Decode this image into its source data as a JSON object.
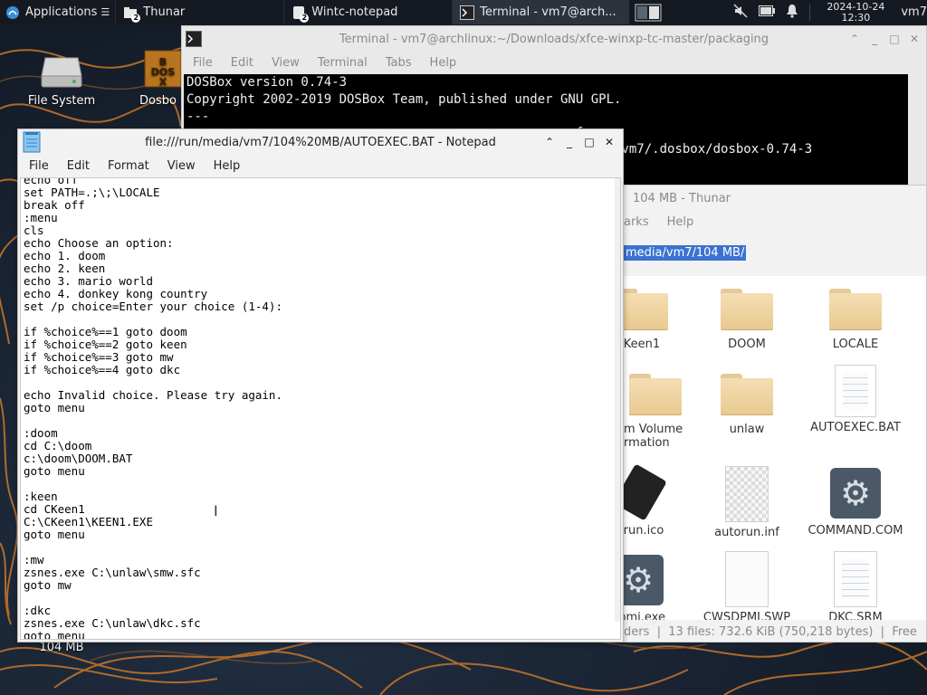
{
  "panel": {
    "applications_label": "Applications",
    "tasks": [
      {
        "label": "Thunar",
        "badge": "2"
      },
      {
        "label": "Wintc-notepad",
        "badge": "2"
      },
      {
        "label": "Terminal - vm7@arch..."
      }
    ],
    "clock_date": "2024-10-24",
    "clock_time": "12:30",
    "user": "vm7"
  },
  "desktop": {
    "icons": [
      {
        "label": "File System"
      },
      {
        "label": "Dosbo"
      },
      {
        "label": "104 MB"
      }
    ]
  },
  "terminal": {
    "title": "Terminal - vm7@archlinux:~/Downloads/xfce-winxp-tc-master/packaging",
    "menu": [
      "File",
      "Edit",
      "View",
      "Terminal",
      "Tabs",
      "Help"
    ],
    "lines": [
      "DOSBox version 0.74-3",
      "Copyright 2002-2019 DOSBox Team, published under GNU GPL.",
      "---",
      "                                                   f",
      "                                                   /home/vm7/.dosbox/dosbox-0.74-3"
    ]
  },
  "thunar": {
    "title": "104 MB - Thunar",
    "menu": [
      "arks",
      "Help"
    ],
    "location": "media/vm7/104 MB/",
    "items": [
      {
        "label": "Keen1",
        "type": "folder"
      },
      {
        "label": "DOOM",
        "type": "folder"
      },
      {
        "label": "LOCALE",
        "type": "folder"
      },
      {
        "label": "m Volume\nrmation",
        "type": "folder"
      },
      {
        "label": "unlaw",
        "type": "folder"
      },
      {
        "label": "AUTOEXEC.BAT",
        "type": "text"
      },
      {
        "label": "orun.ico",
        "type": "usb"
      },
      {
        "label": "autorun.inf",
        "type": "generic"
      },
      {
        "label": "COMMAND.COM",
        "type": "gear"
      },
      {
        "label": "dpmi.exe",
        "type": "gear"
      },
      {
        "label": "CWSDPMI.SWP",
        "type": "blank"
      },
      {
        "label": "DKC.SRM",
        "type": "text"
      }
    ],
    "status": "ders  |  13 files: 732.6 KiB (750,218 bytes)  |  Free"
  },
  "notepad": {
    "title": "file:///run/media/vm7/104%20MB/AUTOEXEC.BAT - Notepad",
    "menu": [
      "File",
      "Edit",
      "Format",
      "View",
      "Help"
    ],
    "text": "echo off\nset PATH=.;\\;\\LOCALE\nbreak off\n:menu\ncls\necho Choose an option:\necho 1. doom\necho 2. keen\necho 3. mario world\necho 4. donkey kong country\nset /p choice=Enter your choice (1-4):\n\nif %choice%==1 goto doom\nif %choice%==2 goto keen\nif %choice%==3 goto mw\nif %choice%==4 goto dkc\n\necho Invalid choice. Please try again.\ngoto menu\n\n:doom\ncd C:\\doom\nc:\\doom\\DOOM.BAT\ngoto menu\n\n:keen\ncd CKeen1\nC:\\CKeen1\\KEEN1.EXE\ngoto menu\n\n:mw\nzsnes.exe C:\\unlaw\\smw.sfc\ngoto mw\n\n:dkc\nzsnes.exe C:\\unlaw\\dkc.sfc\ngoto menu"
  },
  "colors": {
    "panel_bg": "#151a22",
    "selection": "#3b73d0",
    "wallpaper_line": "#c8772a"
  }
}
